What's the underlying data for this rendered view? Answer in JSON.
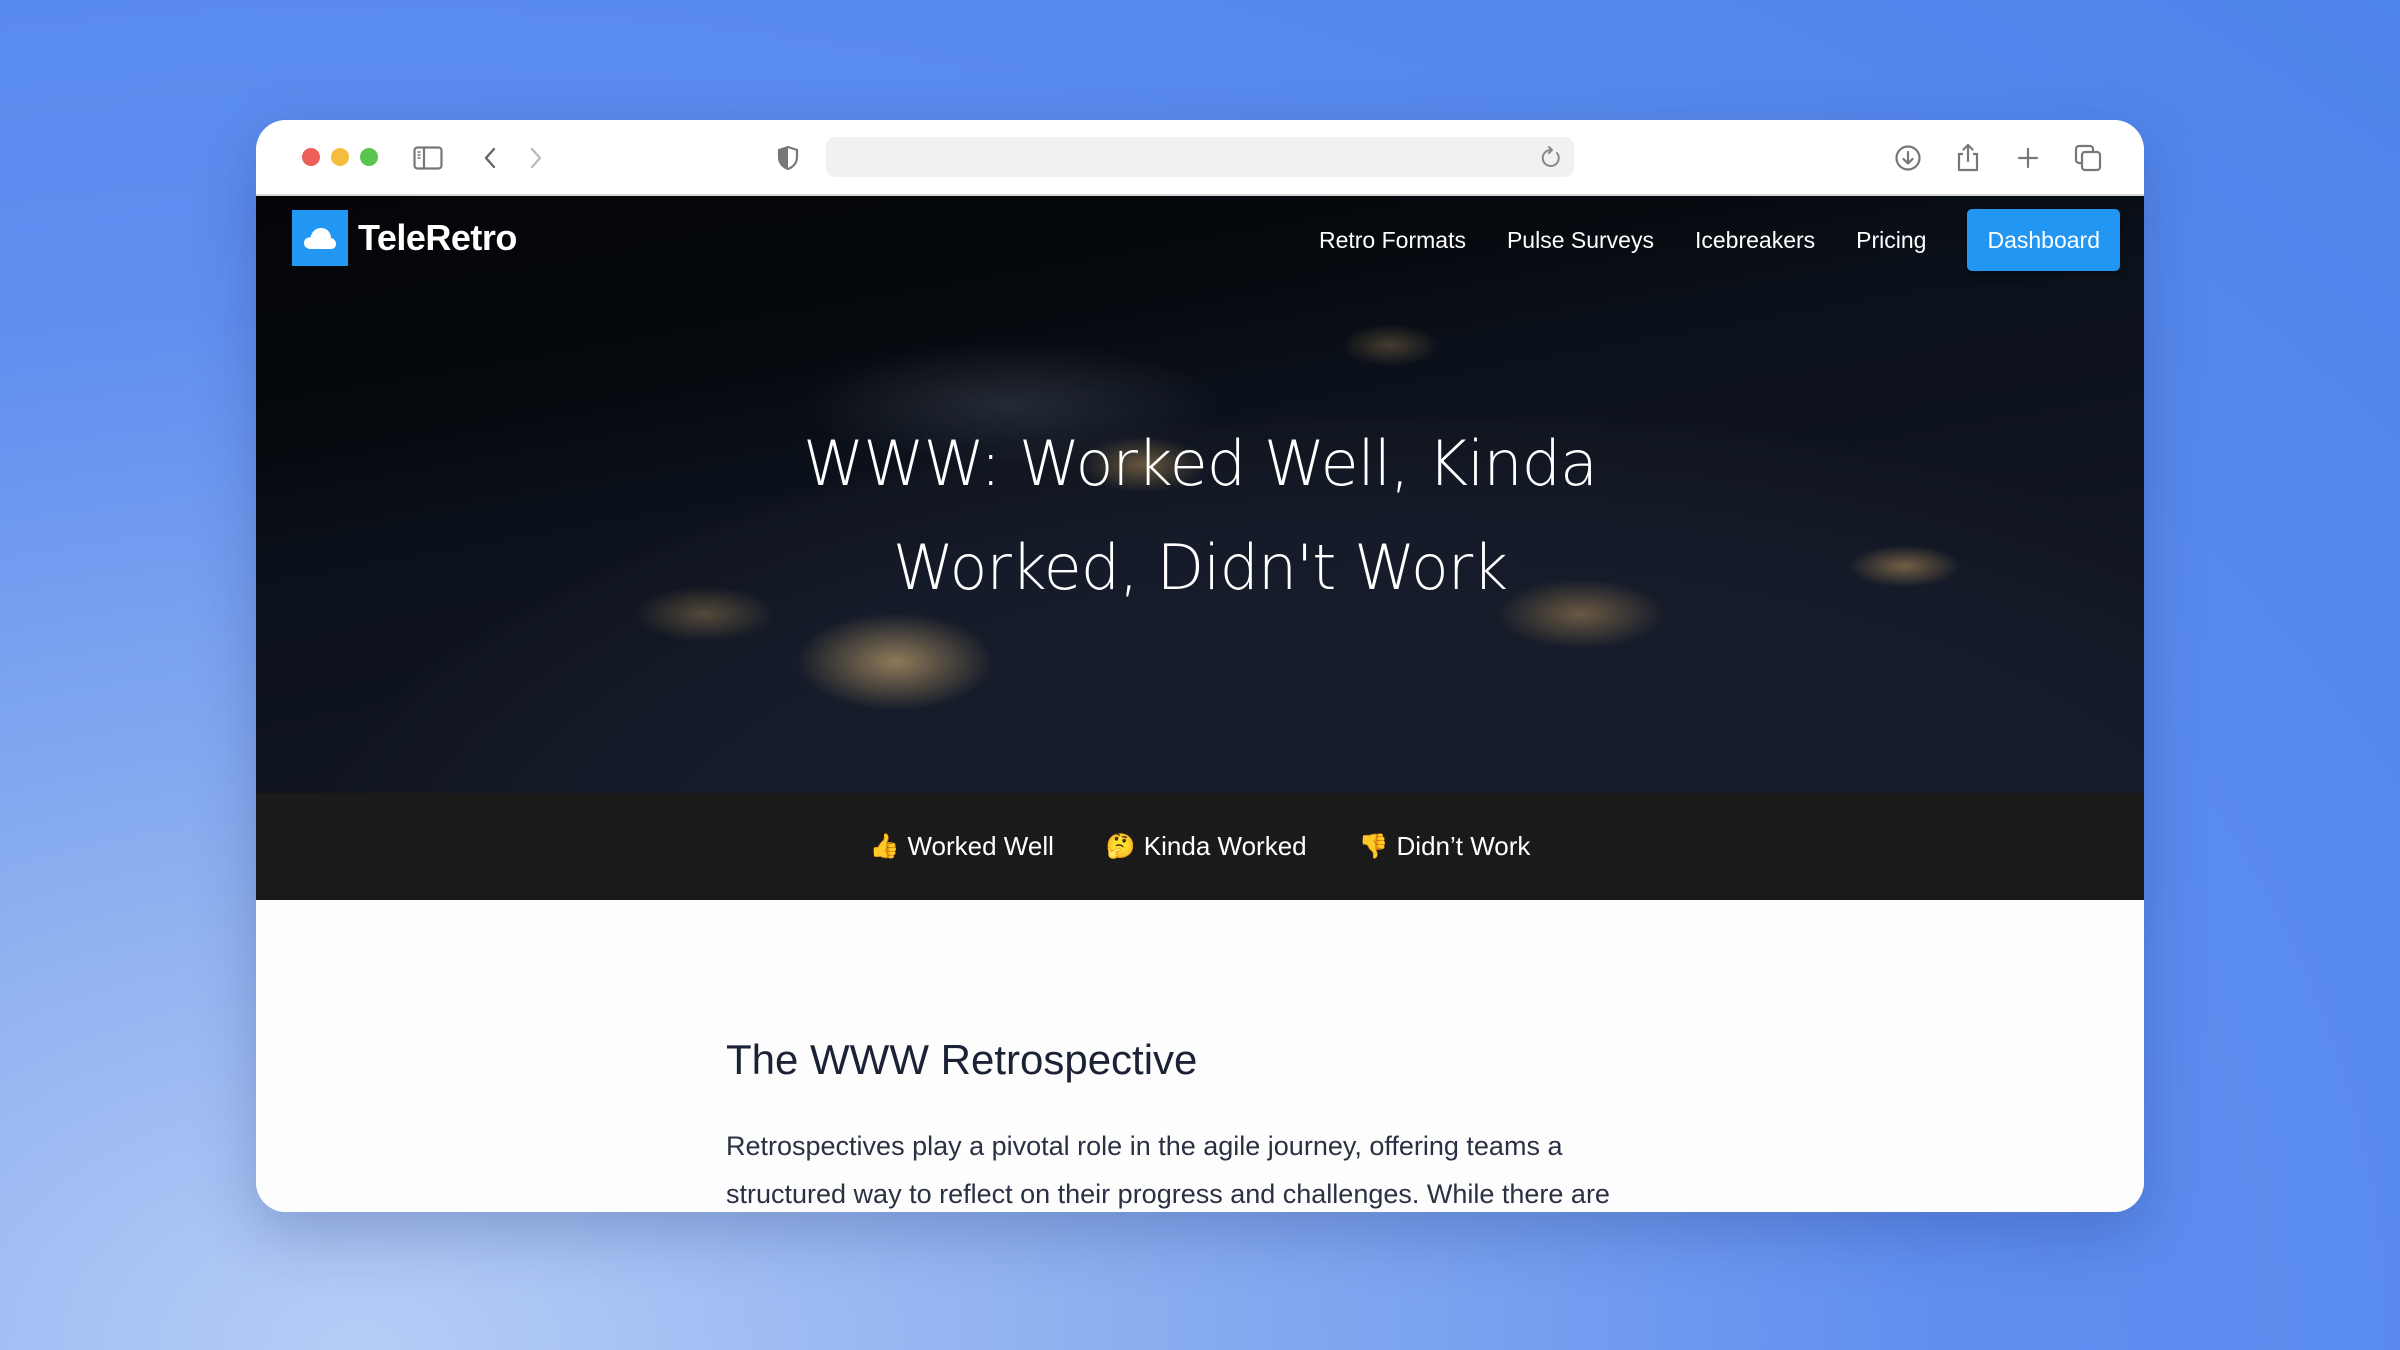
{
  "browser": {
    "icons": {
      "sidebar": "sidebar-icon",
      "back": "chevron-left-icon",
      "forward": "chevron-right-icon",
      "privacy": "shield-icon",
      "reload": "reload-icon",
      "download": "download-icon",
      "share": "share-icon",
      "new_tab": "plus-icon",
      "tabs": "tabs-overview-icon"
    },
    "url": ""
  },
  "nav": {
    "brand": "TeleRetro",
    "links": [
      "Retro Formats",
      "Pulse Surveys",
      "Icebreakers",
      "Pricing"
    ],
    "cta": "Dashboard",
    "accent": "#2196f3"
  },
  "hero": {
    "title_line1": "WWW: Worked Well, Kinda",
    "title_line2": "Worked, Didn't Work"
  },
  "tabs": [
    {
      "emoji": "👍",
      "label": "Worked Well"
    },
    {
      "emoji": "🤔",
      "label": "Kinda Worked"
    },
    {
      "emoji": "👎",
      "label": "Didn’t Work"
    }
  ],
  "article": {
    "heading": "The WWW Retrospective",
    "paragraph": "Retrospectives play a pivotal role in the agile journey, offering teams a structured way to reflect on their progress and challenges. While there are"
  }
}
